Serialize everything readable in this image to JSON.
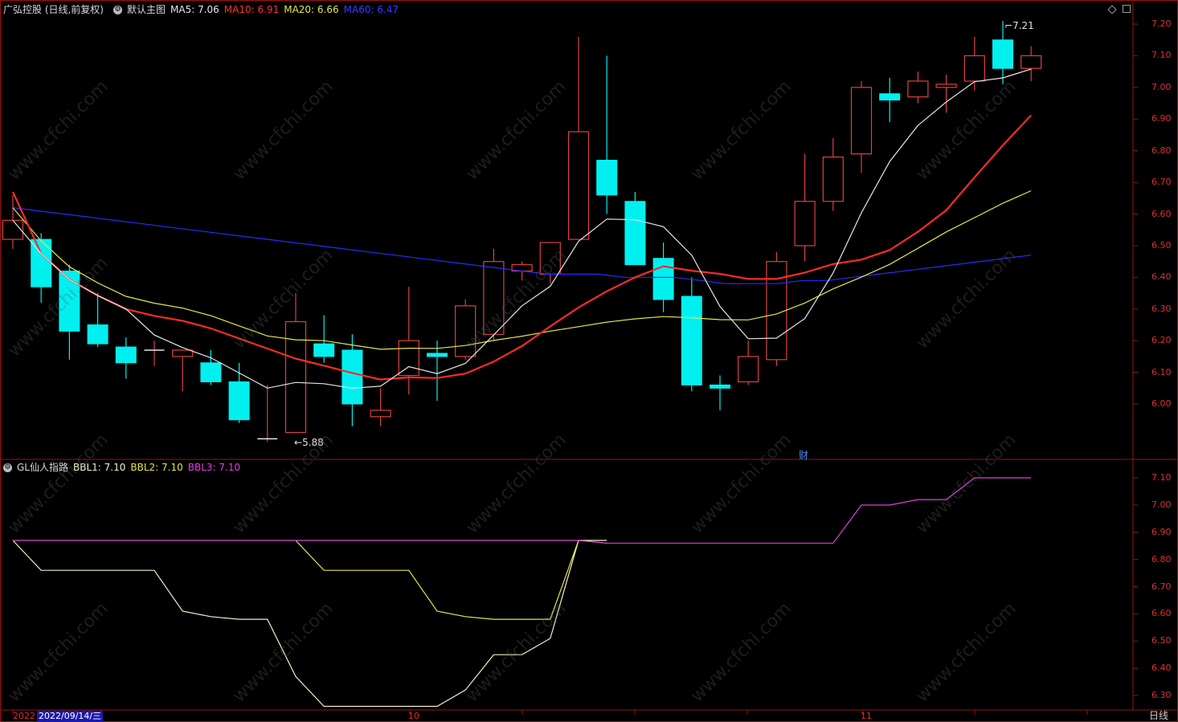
{
  "header": {
    "stock_name": "广弘控股 (日线,前复权)",
    "template": "默认主图",
    "ma5": "MA5: 7.06",
    "ma10": "MA10: 6.91",
    "ma20": "MA20: 6.66",
    "ma60": "MA60: 6.47"
  },
  "sub_header": {
    "indicator": "GL仙人指路",
    "bbl1": "BBL1: 7.10",
    "bbl2": "BBL2: 7.10",
    "bbl3": "BBL3: 7.10"
  },
  "colors": {
    "ma5": "#e6e6e6",
    "ma10": "#ff2a2a",
    "ma20": "#e6e64a",
    "ma60": "#2a2aff",
    "up": "#e04040",
    "down": "#00f0f0",
    "bbl1": "#f0f0c8",
    "bbl2": "#e6e64a",
    "bbl3": "#e040e0",
    "frame": "#a01010",
    "axis_label": "#e03030"
  },
  "main_axis": [
    "7.20",
    "7.10",
    "7.00",
    "6.90",
    "6.80",
    "6.70",
    "6.60",
    "6.50",
    "6.40",
    "6.30",
    "6.20",
    "6.10",
    "6.00"
  ],
  "sub_axis": [
    "7.10",
    "7.00",
    "6.90",
    "6.80",
    "6.70",
    "6.60",
    "6.50",
    "6.40",
    "6.30"
  ],
  "annotations": {
    "high": "7.21",
    "low": "5.88",
    "fin_marker": "财"
  },
  "footer": {
    "year": "2022",
    "cursor_date": "2022/09/14/三",
    "month_10": "10",
    "month_11": "11",
    "period_tab": "日线"
  },
  "chart_data": {
    "type": "candlestick",
    "candles": [
      {
        "o": 6.52,
        "h": 6.66,
        "l": 6.49,
        "c": 6.58
      },
      {
        "o": 6.52,
        "h": 6.54,
        "l": 6.32,
        "c": 6.37
      },
      {
        "o": 6.42,
        "h": 6.44,
        "l": 6.14,
        "c": 6.23
      },
      {
        "o": 6.25,
        "h": 6.35,
        "l": 6.18,
        "c": 6.19
      },
      {
        "o": 6.18,
        "h": 6.21,
        "l": 6.08,
        "c": 6.13
      },
      {
        "o": 6.17,
        "h": 6.2,
        "l": 6.12,
        "c": 6.17
      },
      {
        "o": 6.15,
        "h": 6.17,
        "l": 6.04,
        "c": 6.17
      },
      {
        "o": 6.13,
        "h": 6.17,
        "l": 6.06,
        "c": 6.07
      },
      {
        "o": 6.07,
        "h": 6.13,
        "l": 5.94,
        "c": 5.95
      },
      {
        "o": 5.89,
        "h": 6.06,
        "l": 5.88,
        "c": 5.89
      },
      {
        "o": 5.91,
        "h": 6.35,
        "l": 5.91,
        "c": 6.26
      },
      {
        "o": 6.19,
        "h": 6.28,
        "l": 6.13,
        "c": 6.15
      },
      {
        "o": 6.17,
        "h": 6.22,
        "l": 5.93,
        "c": 6.0
      },
      {
        "o": 5.96,
        "h": 6.05,
        "l": 5.93,
        "c": 5.98
      },
      {
        "o": 6.09,
        "h": 6.37,
        "l": 6.03,
        "c": 6.2
      },
      {
        "o": 6.16,
        "h": 6.2,
        "l": 6.01,
        "c": 6.15
      },
      {
        "o": 6.15,
        "h": 6.33,
        "l": 6.14,
        "c": 6.31
      },
      {
        "o": 6.22,
        "h": 6.49,
        "l": 6.2,
        "c": 6.45
      },
      {
        "o": 6.42,
        "h": 6.45,
        "l": 6.39,
        "c": 6.44
      },
      {
        "o": 6.41,
        "h": 6.51,
        "l": 6.38,
        "c": 6.51
      },
      {
        "o": 6.52,
        "h": 7.16,
        "l": 6.52,
        "c": 6.86
      },
      {
        "o": 6.77,
        "h": 7.1,
        "l": 6.6,
        "c": 6.66
      },
      {
        "o": 6.64,
        "h": 6.67,
        "l": 6.44,
        "c": 6.44
      },
      {
        "o": 6.46,
        "h": 6.51,
        "l": 6.29,
        "c": 6.33
      },
      {
        "o": 6.34,
        "h": 6.4,
        "l": 6.04,
        "c": 6.06
      },
      {
        "o": 6.06,
        "h": 6.09,
        "l": 5.98,
        "c": 6.05
      },
      {
        "o": 6.07,
        "h": 6.2,
        "l": 6.06,
        "c": 6.15
      },
      {
        "o": 6.14,
        "h": 6.48,
        "l": 6.12,
        "c": 6.45
      },
      {
        "o": 6.5,
        "h": 6.79,
        "l": 6.45,
        "c": 6.64
      },
      {
        "o": 6.64,
        "h": 6.84,
        "l": 6.61,
        "c": 6.78
      },
      {
        "o": 6.79,
        "h": 7.02,
        "l": 6.73,
        "c": 7.0
      },
      {
        "o": 6.98,
        "h": 7.03,
        "l": 6.89,
        "c": 6.96
      },
      {
        "o": 6.97,
        "h": 7.05,
        "l": 6.95,
        "c": 7.02
      },
      {
        "o": 7.0,
        "h": 7.04,
        "l": 6.92,
        "c": 7.01
      },
      {
        "o": 7.02,
        "h": 7.16,
        "l": 6.99,
        "c": 7.1
      },
      {
        "o": 7.15,
        "h": 7.21,
        "l": 7.01,
        "c": 7.06
      },
      {
        "o": 7.06,
        "h": 7.13,
        "l": 7.02,
        "c": 7.1
      }
    ],
    "ma5": [
      6.63,
      6.58,
      6.52,
      6.46,
      6.4,
      6.34,
      6.28,
      6.22,
      6.18,
      6.14,
      6.11,
      6.06,
      6.06,
      6.07,
      6.07,
      6.06,
      6.07,
      6.09,
      6.13,
      6.21,
      6.3,
      6.37,
      6.44,
      6.5,
      6.58,
      6.58,
      6.51,
      6.46,
      6.36,
      6.28,
      6.21,
      6.21,
      6.27,
      6.4,
      6.55,
      6.69,
      6.79,
      6.89,
      6.96,
      7.02,
      7.03,
      7.06
    ],
    "ma60": [
      6.62,
      6.61,
      6.6,
      6.59,
      6.58,
      6.57,
      6.56,
      6.55,
      6.54,
      6.53,
      6.52,
      6.51,
      6.5,
      6.49,
      6.48,
      6.47,
      6.46,
      6.45,
      6.44,
      6.43,
      6.42,
      6.41,
      6.41,
      6.41,
      6.4,
      6.4,
      6.4,
      6.39,
      6.38,
      6.38,
      6.38,
      6.39,
      6.39,
      6.4,
      6.41,
      6.42,
      6.43,
      6.44,
      6.45,
      6.46,
      6.47
    ]
  }
}
